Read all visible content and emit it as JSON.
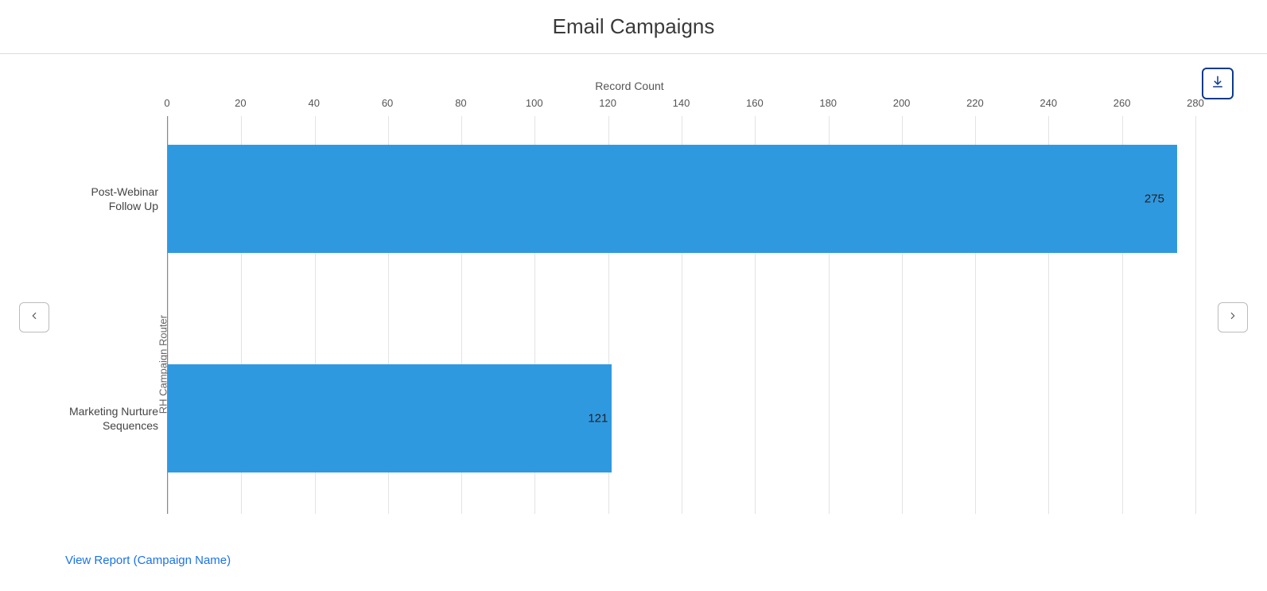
{
  "header": {
    "title": "Email Campaigns"
  },
  "actions": {
    "download_name": "download-button",
    "prev_name": "prev-button",
    "next_name": "next-button"
  },
  "footer": {
    "link_text": "View Report (Campaign Name)"
  },
  "chart_data": {
    "type": "bar",
    "orientation": "horizontal",
    "title": "Email Campaigns",
    "xlabel": "Record Count",
    "ylabel": "RH Campaign Router",
    "xlim": [
      0,
      280
    ],
    "xticks": [
      0,
      20,
      40,
      60,
      80,
      100,
      120,
      140,
      160,
      180,
      200,
      220,
      240,
      260,
      280
    ],
    "categories": [
      "Post-Webinar Follow Up",
      "Marketing Nurture Sequences"
    ],
    "values": [
      275,
      121
    ],
    "color": "#2f99e0"
  }
}
